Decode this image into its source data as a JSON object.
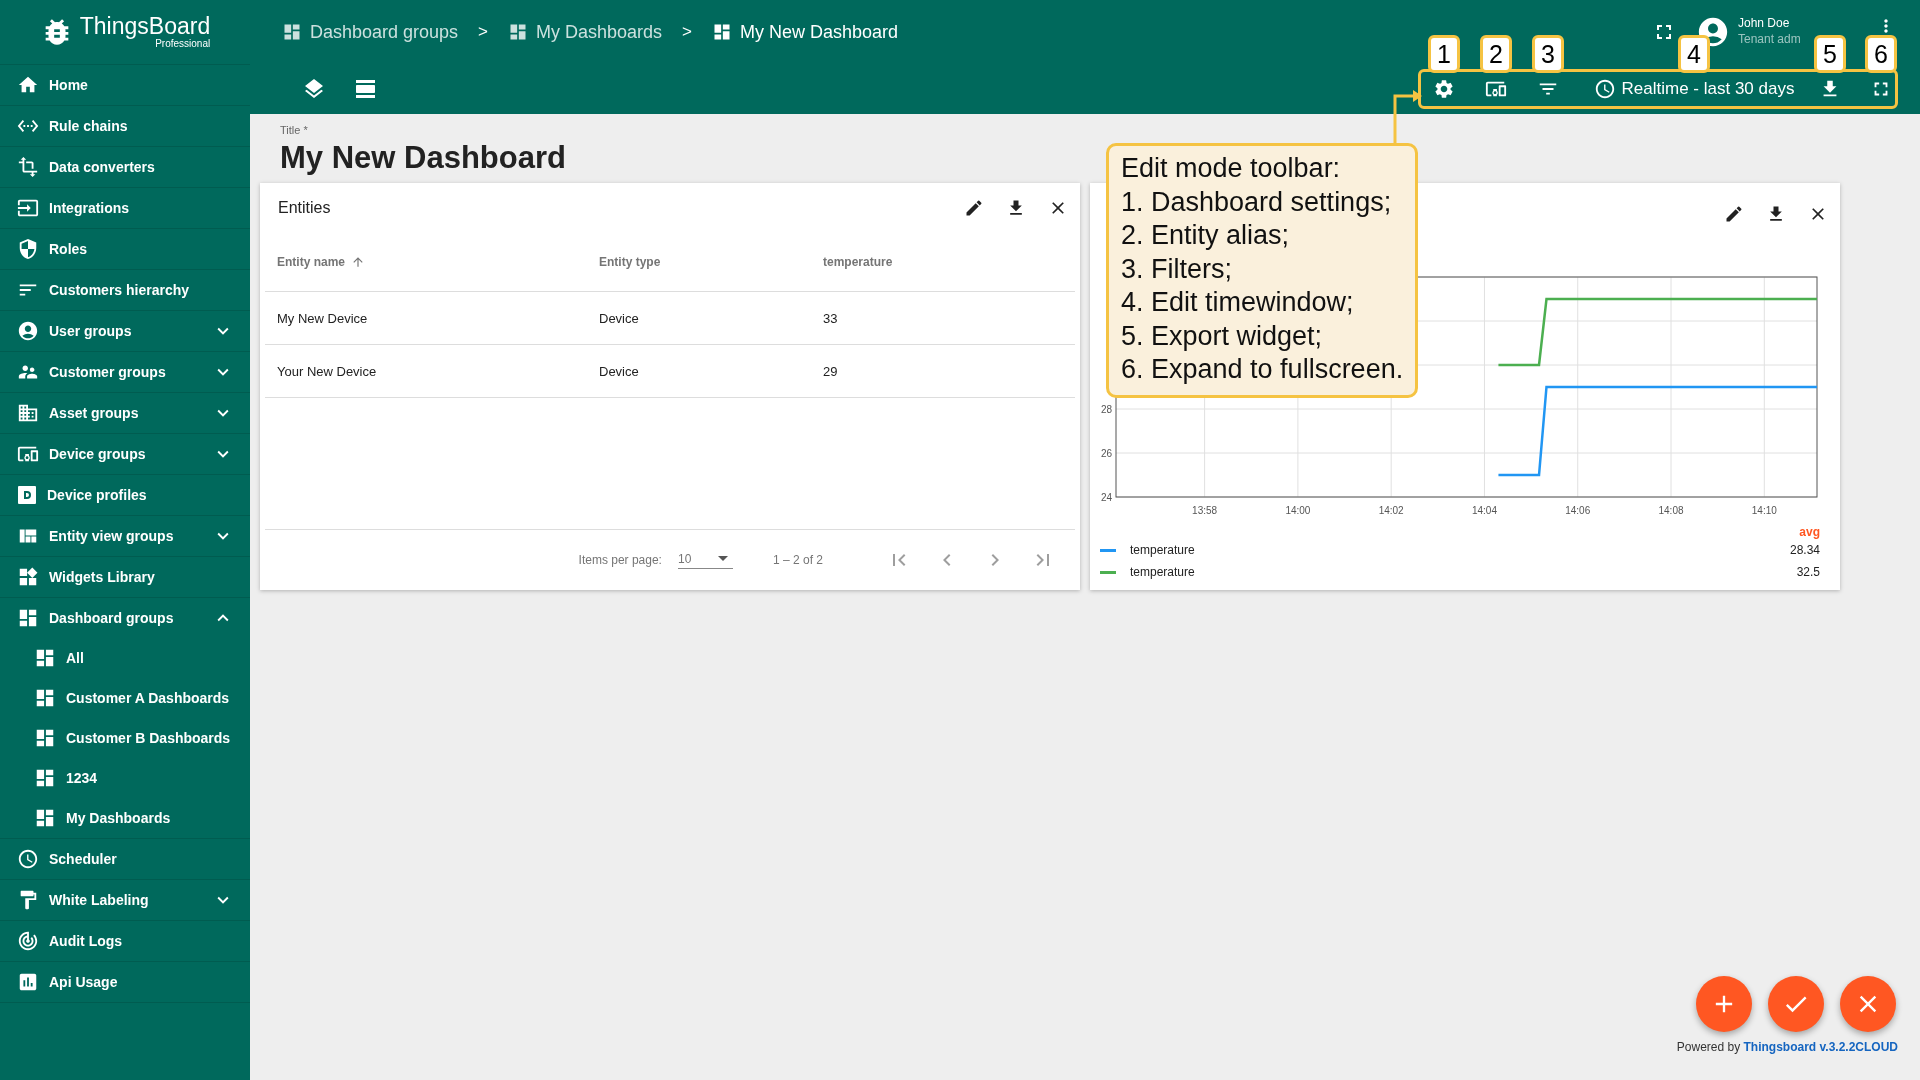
{
  "sidebar": {
    "logo": {
      "name": "ThingsBoard",
      "edition": "Professional"
    },
    "items": [
      {
        "label": "Home"
      },
      {
        "label": "Rule chains"
      },
      {
        "label": "Data converters"
      },
      {
        "label": "Integrations"
      },
      {
        "label": "Roles"
      },
      {
        "label": "Customers hierarchy"
      },
      {
        "label": "User groups",
        "expanded": false
      },
      {
        "label": "Customer groups",
        "expanded": false
      },
      {
        "label": "Asset groups",
        "expanded": false
      },
      {
        "label": "Device groups",
        "expanded": false
      },
      {
        "label": "Device profiles"
      },
      {
        "label": "Entity view groups",
        "expanded": false
      },
      {
        "label": "Widgets Library"
      },
      {
        "label": "Dashboard groups",
        "expanded": true,
        "children": [
          {
            "label": "All"
          },
          {
            "label": "Customer A Dashboards"
          },
          {
            "label": "Customer B Dashboards"
          },
          {
            "label": "1234"
          },
          {
            "label": "My Dashboards"
          }
        ]
      },
      {
        "label": "Scheduler"
      },
      {
        "label": "White Labeling",
        "expanded": false
      },
      {
        "label": "Audit Logs"
      },
      {
        "label": "Api Usage"
      }
    ]
  },
  "header": {
    "breadcrumbs": [
      {
        "label": "Dashboard groups",
        "separator": ">"
      },
      {
        "label": "My Dashboards",
        "separator": ">"
      },
      {
        "label": "My New Dashboard"
      }
    ],
    "user": {
      "name": "John Doe",
      "role": "Tenant adm"
    }
  },
  "toolbar": {
    "items": [
      {
        "kind": "settings",
        "badge": "1"
      },
      {
        "kind": "alias",
        "badge": "2"
      },
      {
        "kind": "filter",
        "badge": "3"
      },
      {
        "kind": "timewindow",
        "label": "Realtime - last 30 days",
        "badge": "4"
      },
      {
        "kind": "export",
        "badge": "5"
      },
      {
        "kind": "fullscreen",
        "badge": "6"
      }
    ]
  },
  "title_field": {
    "label": "Title *",
    "value": "My New Dashboard"
  },
  "entities_widget": {
    "title": "Entities",
    "columns": [
      {
        "label": "Entity name",
        "sorted": true
      },
      {
        "label": "Entity type",
        "sorted": false
      },
      {
        "label": "temperature",
        "sorted": false
      }
    ],
    "rows": [
      [
        "My New Device",
        "Device",
        "33"
      ],
      [
        "Your New Device",
        "Device",
        "29"
      ]
    ],
    "pagination": {
      "items_per_page_label": "Items per page:",
      "page_size": "10",
      "range": "1 – 2 of 2"
    }
  },
  "chart_widget": {
    "chart_data": {
      "type": "line",
      "x": [
        844.3,
        845.17,
        845.33,
        851.13
      ],
      "series": [
        {
          "name": "temperature",
          "color": "#2196f3",
          "values": [
            25,
            25,
            29,
            29
          ]
        },
        {
          "name": "temperature",
          "color": "#4caf50",
          "values": [
            30,
            30,
            33,
            33
          ]
        }
      ],
      "xlim": [
        836.1,
        851.13
      ],
      "ylim": [
        24,
        34
      ],
      "grid": true,
      "xticks": [
        {
          "value": 838,
          "label": "13:58"
        },
        {
          "value": 840,
          "label": "14:00"
        },
        {
          "value": 842,
          "label": "14:02"
        },
        {
          "value": 844,
          "label": "14:04"
        },
        {
          "value": 846,
          "label": "14:06"
        },
        {
          "value": 848,
          "label": "14:08"
        },
        {
          "value": 850,
          "label": "14:10"
        }
      ],
      "yticks": [
        24,
        26,
        28
      ]
    },
    "legend": {
      "header": "avg",
      "items": [
        {
          "value": "28.34"
        },
        {
          "value": "32.5"
        }
      ]
    }
  },
  "callout": {
    "lines": [
      "Edit mode toolbar:",
      "1. Dashboard settings;",
      "2. Entity alias;",
      "3. Filters;",
      "4. Edit timewindow;",
      "5. Export widget;",
      "6. Expand to fullscreen."
    ]
  },
  "fab_buttons": [
    {
      "kind": "add"
    },
    {
      "kind": "save"
    },
    {
      "kind": "cancel"
    }
  ],
  "footer": {
    "prefix": "Powered by",
    "link": "Thingsboard v.3.2.2CLOUD"
  }
}
